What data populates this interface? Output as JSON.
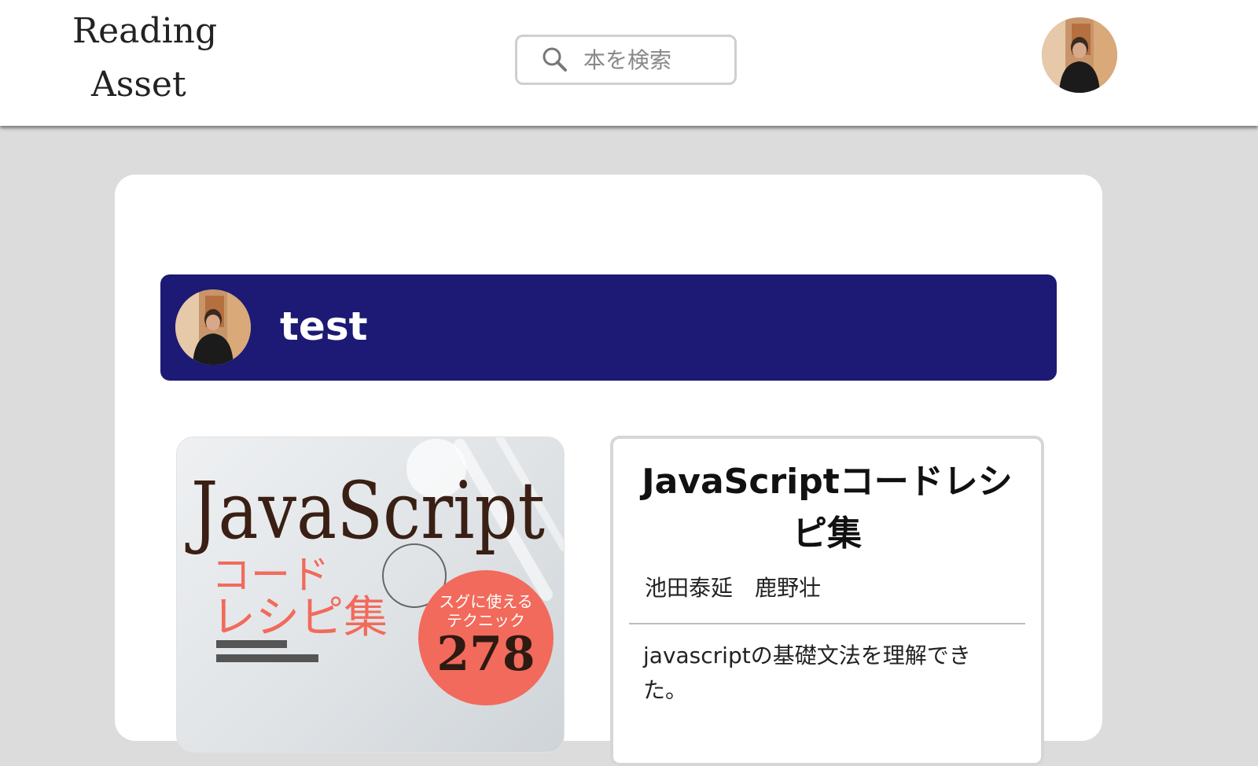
{
  "header": {
    "logo_line1": "Reading",
    "logo_line2": "Asset",
    "search_placeholder": "本を検索",
    "search_icon": "search-icon",
    "avatar_icon": "user-avatar"
  },
  "user": {
    "name": "test"
  },
  "book": {
    "cover_title": "JavaScript",
    "cover_subtitle_line1": "コード",
    "cover_subtitle_line2": "レシピ集",
    "cover_badge_top": "スグに使える",
    "cover_badge_mid": "テクニック",
    "cover_badge_number": "278",
    "title": "JavaScriptコードレシピ集",
    "authors": "池田泰延　鹿野壮",
    "review": "javascriptの基礎文法を理解できた。"
  },
  "colors": {
    "background": "#dcdcdc",
    "user_bar": "#1c1a74",
    "cover_accent": "#f26a5b",
    "card": "#ffffff"
  }
}
